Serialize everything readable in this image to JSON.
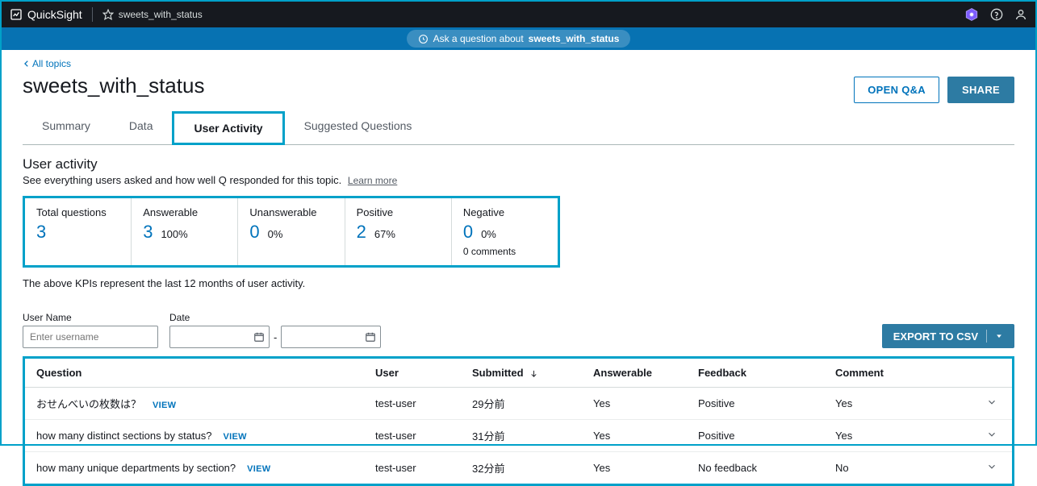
{
  "topbar": {
    "product": "QuickSight",
    "topic_name": "sweets_with_status"
  },
  "banner": {
    "prefix": "Ask a question about ",
    "topic": "sweets_with_status"
  },
  "nav": {
    "back": "All topics"
  },
  "page": {
    "title": "sweets_with_status"
  },
  "actions": {
    "open_qa": "OPEN Q&A",
    "share": "SHARE"
  },
  "tabs": {
    "summary": "Summary",
    "data": "Data",
    "user_activity": "User Activity",
    "suggested": "Suggested Questions"
  },
  "panel": {
    "title": "User activity",
    "subtitle": "See everything users asked and how well Q responded for this topic.",
    "learn_more": "Learn more"
  },
  "kpis": {
    "total": {
      "label": "Total questions",
      "value": "3"
    },
    "answerable": {
      "label": "Answerable",
      "value": "3",
      "pct": "100%"
    },
    "unanswerable": {
      "label": "Unanswerable",
      "value": "0",
      "pct": "0%"
    },
    "positive": {
      "label": "Positive",
      "value": "2",
      "pct": "67%"
    },
    "negative": {
      "label": "Negative",
      "value": "0",
      "pct": "0%",
      "extra": "0 comments"
    }
  },
  "kpi_note": "The above KPIs represent the last 12 months of user activity.",
  "filters": {
    "username_label": "User Name",
    "username_placeholder": "Enter username",
    "date_label": "Date",
    "date_sep": "-"
  },
  "export": {
    "label": "EXPORT TO CSV"
  },
  "table": {
    "headers": {
      "question": "Question",
      "user": "User",
      "submitted": "Submitted",
      "answerable": "Answerable",
      "feedback": "Feedback",
      "comment": "Comment"
    },
    "view_link": "VIEW",
    "rows": [
      {
        "question": "おせんべいの枚数は？",
        "user": "test-user",
        "submitted": "29分前",
        "answerable": "Yes",
        "feedback": "Positive",
        "comment": "Yes"
      },
      {
        "question": "how many distinct sections by status?",
        "user": "test-user",
        "submitted": "31分前",
        "answerable": "Yes",
        "feedback": "Positive",
        "comment": "Yes"
      },
      {
        "question": "how many unique departments by section?",
        "user": "test-user",
        "submitted": "32分前",
        "answerable": "Yes",
        "feedback": "No feedback",
        "comment": "No"
      }
    ]
  }
}
